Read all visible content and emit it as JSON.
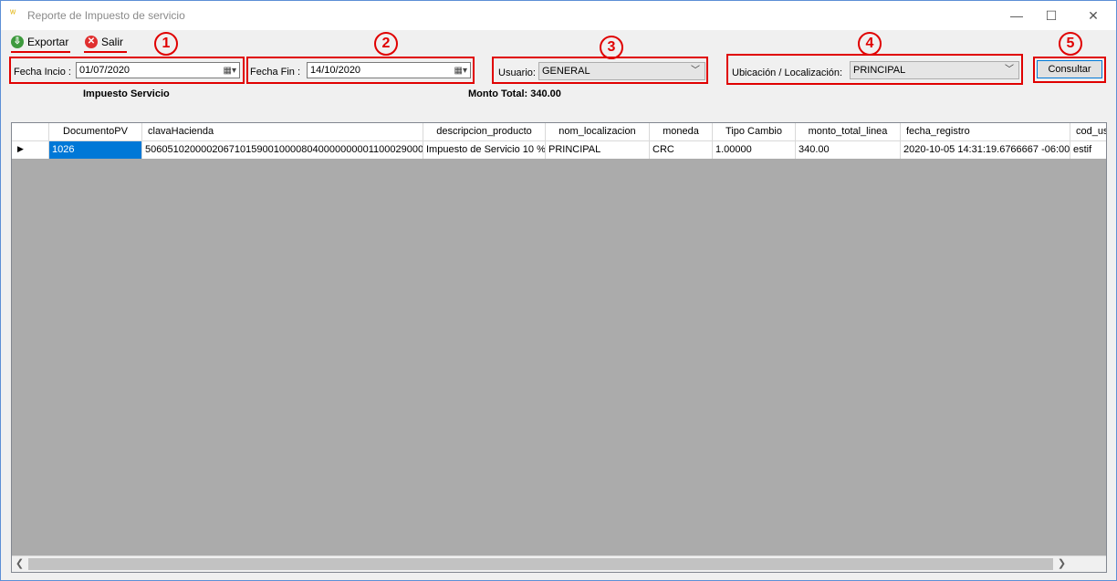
{
  "window": {
    "title": "Reporte de Impuesto de servicio",
    "app_icon": "app-icon",
    "minimize": "—",
    "maximize": "☐",
    "close": "✕"
  },
  "toolbar": {
    "export_label": "Exportar",
    "exit_label": "Salir"
  },
  "filters": {
    "fecha_inicio_label": "Fecha Incio :",
    "fecha_inicio_value": "01/07/2020",
    "fecha_fin_label": "Fecha Fin :",
    "fecha_fin_value": "14/10/2020",
    "usuario_label": "Usuario:",
    "usuario_value": "GENERAL",
    "ubicacion_label": "Ubicación / Localización:",
    "ubicacion_value": "PRINCIPAL",
    "consultar_label": "Consultar"
  },
  "annotations": [
    "1",
    "2",
    "3",
    "4",
    "5"
  ],
  "summary": {
    "section_title": "Impuesto Servicio",
    "monto_total": "Monto Total: 340.00"
  },
  "grid": {
    "columns": [
      "DocumentoPV",
      "clavaHacienda",
      "descripcion_producto",
      "nom_localizacion",
      "moneda",
      "Tipo Cambio",
      "monto_total_linea",
      "fecha_registro",
      "cod_us"
    ],
    "rows": [
      [
        "1026",
        "50605102000020671015900100008040000000001100029000",
        "Impuesto de Servicio 10 %",
        "PRINCIPAL",
        "CRC",
        "1.00000",
        "340.00",
        "2020-10-05 14:31:19.6766667 -06:00",
        "estif"
      ]
    ]
  },
  "colors": {
    "annotation_red": "#e00000",
    "selection_blue": "#0078d7",
    "grid_background": "#ababab"
  }
}
